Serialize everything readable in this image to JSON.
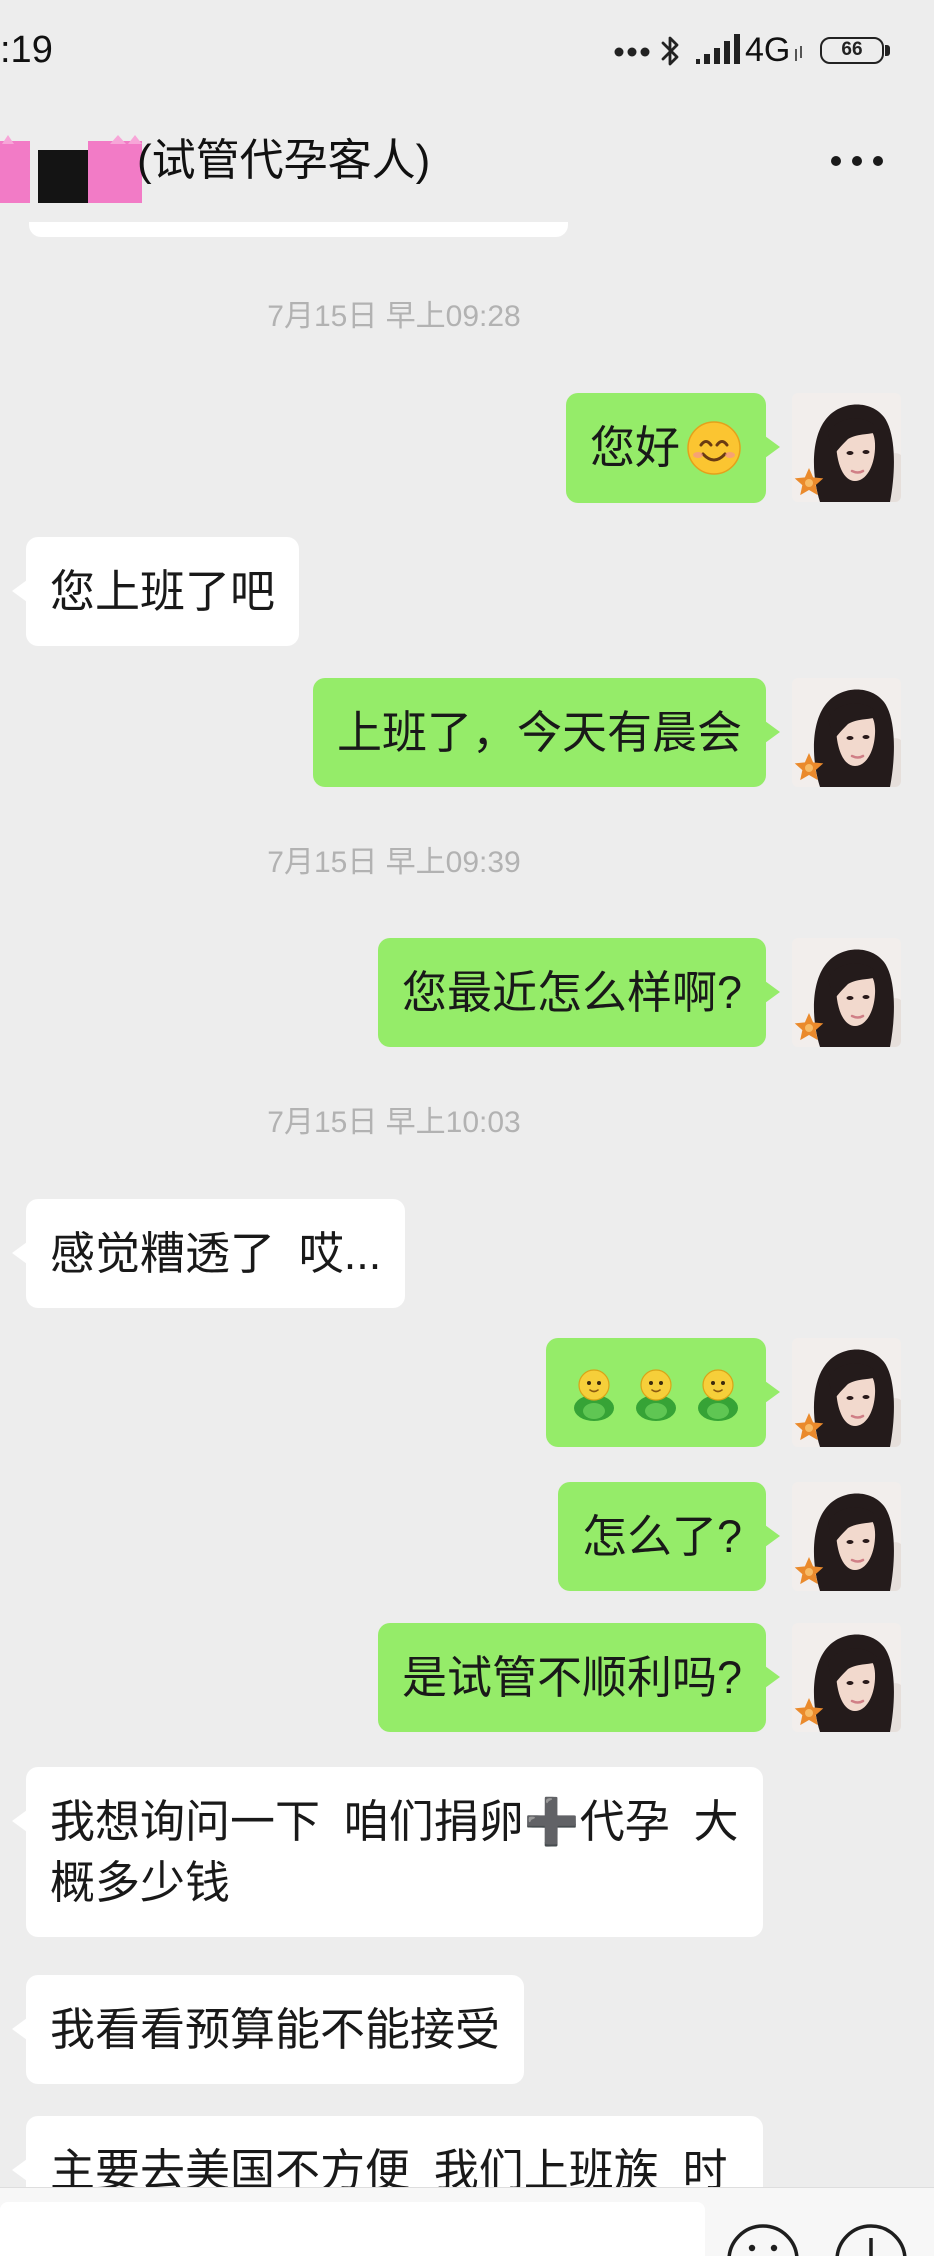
{
  "status_bar": {
    "time": ":19",
    "network_type": "4G",
    "battery_level": "66",
    "icons": [
      "more-notifications-icon",
      "bluetooth-icon",
      "signal-icon",
      "data-activity-icon",
      "battery-icon"
    ]
  },
  "header": {
    "title": "(试管代孕客人)",
    "avatar": "pixelated-avatar",
    "more_icon": "more-icon"
  },
  "self_avatar": "user-photo-avatar",
  "messages": [
    {
      "timestamp": "7月15日 早上09:28"
    },
    {
      "outgoing": true,
      "text": "您好",
      "emoji": "smiling-face-icon"
    },
    {
      "outgoing": false,
      "text": "您上班了吧"
    },
    {
      "outgoing": true,
      "text": "上班了，今天有晨会"
    },
    {
      "timestamp": "7月15日 早上09:39"
    },
    {
      "outgoing": true,
      "text": "您最近怎么样啊?"
    },
    {
      "timestamp": "7月15日 早上10:03"
    },
    {
      "outgoing": false,
      "text": "感觉糟透了 哎..."
    },
    {
      "outgoing": true,
      "emojis": [
        "green-chick-icon",
        "green-chick-icon",
        "green-chick-icon"
      ]
    },
    {
      "outgoing": true,
      "text": "怎么了?"
    },
    {
      "outgoing": true,
      "text": "是试管不顺利吗?"
    },
    {
      "outgoing": false,
      "text": "我想询问一下 咱们捐卵➕代孕 大概多少钱"
    },
    {
      "outgoing": false,
      "text": "我看看预算能不能接受"
    },
    {
      "outgoing": false,
      "text": "主要去美国不方便 我们上班族 时间"
    }
  ],
  "input_bar": {
    "icons": [
      "emoji-icon",
      "plus-icon"
    ]
  },
  "colors": {
    "background": "#ededed",
    "sent_bubble": "#95ec69",
    "received_bubble": "#ffffff",
    "timestamp": "#b2b2b2"
  }
}
